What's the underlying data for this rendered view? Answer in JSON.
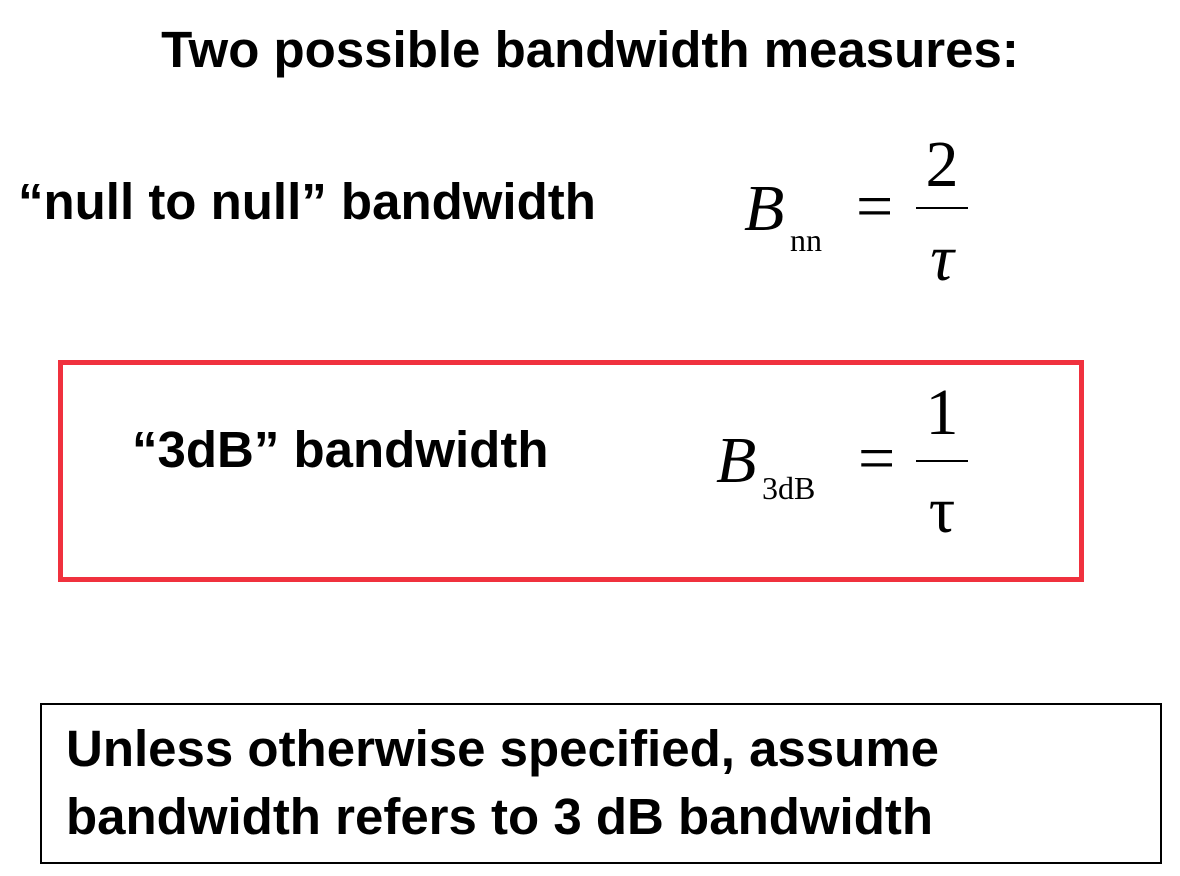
{
  "title": "Two possible bandwidth measures:",
  "measures": [
    {
      "label": "“null to null” bandwidth",
      "formula": {
        "symbol": "B",
        "subscript": "nn",
        "equals": "=",
        "numerator": "2",
        "denominator": "τ"
      }
    },
    {
      "label": "“3dB” bandwidth",
      "formula": {
        "symbol": "B",
        "subscript": "3dB",
        "equals": "=",
        "numerator": "1",
        "denominator": "τ"
      }
    }
  ],
  "highlight_color": "#f0313e",
  "note": {
    "line1": "Unless otherwise specified, assume",
    "line2": "bandwidth refers to 3 dB bandwidth"
  }
}
